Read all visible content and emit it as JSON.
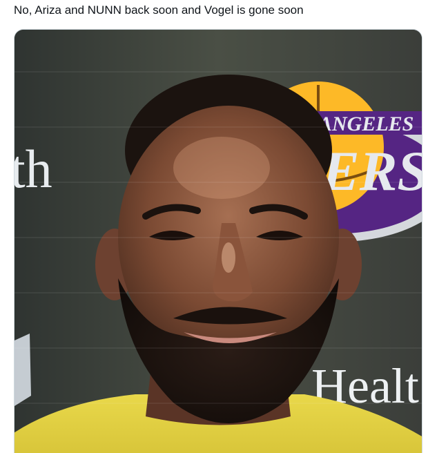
{
  "tweet": {
    "text": "No, Ariza and NUNN back soon and Vogel is gone soon"
  },
  "media": {
    "backdrop_text_left": "th",
    "backdrop_text_bottom": "Healt",
    "logo_text_top": "ANGELES",
    "logo_text_main": "ERS",
    "colors": {
      "lakers_purple": "#552583",
      "lakers_gold": "#fdb927",
      "shirt_yellow": "#e6d33a"
    }
  }
}
